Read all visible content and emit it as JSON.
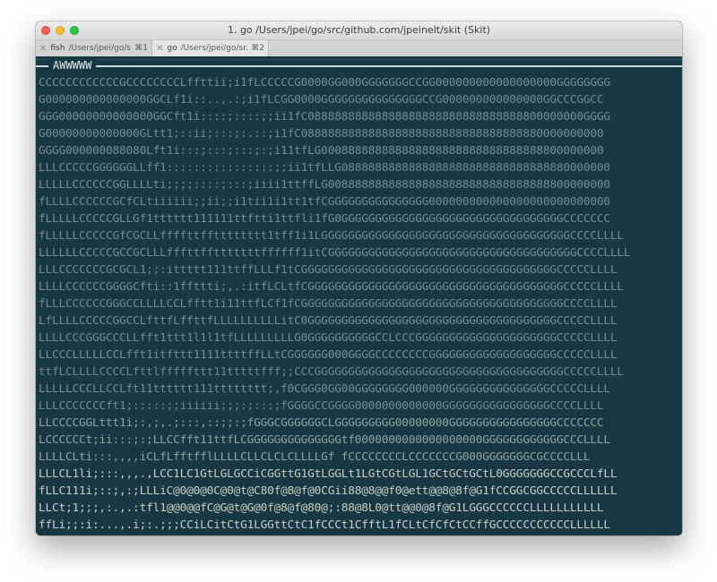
{
  "window": {
    "title": "1. go  /Users/jpei/go/src/github.com/jpeinelt/skit (Skit)"
  },
  "tabs": [
    {
      "name": "fish",
      "path": "/Users/jpei/go/s...",
      "shortcut": "⌘1"
    },
    {
      "name": "go",
      "path": "/Users/jpei/go/sr...",
      "shortcut": "⌘2"
    }
  ],
  "terminal": {
    "box_title": "AWWWWW",
    "ascii_rows": [
      "CCCCCCCCCCCCGCCCCCCCCLffttii;i1fLCCCCCG0000GG000GGGGGGGCCGG000000000000000000GGGGGGGG",
      "G000000000000000GGCLf1i::..,.:;i1fLCGG0000GGGGGGGGGGGGGGGCCG000000000000000GGCCCGGCC",
      "GGG00000000000000GGCft1i::::;::::;;ii1fC08888888888888888888888888888888800000000GGGG",
      "G00000000000000GLtt1;::ii;:::;:.::;i1fC088888888888888888888888888888888880000000000",
      "GGGG000000088080Lft1i:::;:::;:::;:;i11tfLG000888888888888888888888888888888800000000",
      "LLLCCCCCGGGGGGLLff1::::::::::::::::;;ii1tfLLG0888888888888888888888888888888880000000",
      "LLLLLCCCCCCGGLLLLti;;;;::::;:::;iiii1ttffLG008888888888888888888888888888888800000000",
      "fLLLLCCCCCCGCfCLtiiiiii;;ii;;i1tii1i1tt1tfCGGGGGGGGGGGGGGG000000000000000000000000000",
      "fLLLLLCCCCCGLLGf1tttttt111111ttftti1ttfli1fG0GGGGGGGGGGGGGGGGGGGGGGGGGGGGGGGGGCCCCCCC",
      "fLLLLLCCCCCGfCGCLLffffttfftttttttt1tff1i1LGGGGGGGGGGGGGGGGGGGGGGGGGGGGGGGGGGGGGCCCCLLLL",
      "LLLLLLCCCCCGCCGCLLLfffttfftttttttffffff1itCGGGGGGGGGGGGGGGGGGGGGGGGGGGGGGGGGGGGGCCCCLLLL",
      "LLLCCCCCCCGCGCL1;;:ittttt111ttffLLLf1tCGGGGGGGGGGGGGGGGGGGGGGGGGGGGGGGGGGGGGGCCCCCLLLL",
      "LLLLCCCCCCGGGGCfti::1ffttti;,.:itfLCLtfCGGGGGGGGGGGGGGGGGGGGGGGGGGGGGGGGGGGGGGCCCCCLLLL",
      "fLLLCCCCCCGGGCCLLLLCCLfftt1i11ttfLCf1fCGGGGGGGGGGGGGGGGGGGGGGGGGGGGGGGGGGGGGGGCCCCLLLL",
      "LfLLLLCCCCCGGCCLfttfLffttfLLLLLLLLLLitC0GGGGGGGGGGGGGGGGGGGGGGGGGGGGGGGGGGGGGCCCCCLLLL",
      "LLLLCCCGGGCCCLLfft1ttt1l1l1tfLLLLLLLLLG0GGGGGGGGGGCCLCCCGGGGGGGGGGGGGGGGGGGGGCCCCCLLLL",
      "LLCCCLLLLLCCLfft1itfttt1111ttttffLLtCGGGGGG000GGGGCCCCCCCCGGGGGGGGGGGGGGGGGGGCCCCCLLLL",
      "ttfLCLLLLCCCCLfttlfffffttt11tttttfff;;CCCGGGGGGGGGGGGGGGGGGGGGGGGGGGGGGGGGGGGGCCCCCLLLL",
      "LLLLLCCCLLCCLft11tttttt111tttttttt;,f0CGGG0GG00GGGGGGGG000000GGGGGGGGGGGGGGGCCCCCLLLL",
      "LLLCCCCCCCft1;:::::;;iiiiii;;;:;:::;fGGGGCCGGGG0000000000000GGGGGGGGGGGGGGGGCCCCLLLL",
      "LLCCCCGGLttt1i;:,;,.;:::,::;;:;fGGGCGGGGGGCLGGGGGGGGG00000000GGGGGGGGGGGGGGGGCCCCCCC",
      "LCCCCCCt;ii:::;:;LLCCfft11ttfLCGGGGGGGGGGGGGGtf0000000000000000000GGGGGGGGGGGGCCCLLLL",
      "LLLLCLti:::,,,,iCLfLfftfflLLLLCLLCLCLCLLLLGf fCCCCCCCCLCCCCCCCG000GGGGGGGCGCCCCLLL",
      "LLLCL1li;:::,,,.,LCC1LC1GtLGLGCCiCGGttG1GtLGGLt1LGtCGtLGL1GCtGCtGCtL0GGGGGGGCCGCCCLfLL",
      "fLLC111i;::;,:;LLLiC@0@0@0C@0@t@C80f@8@f@0CGii88@8@@f0@ett@@8@8f@G1fCCGGCGGCCCCCLLLLLL",
      "LLCt;1;;;,:.,.:tfl1@@0@@fC@G@t@G@0f@8@f@80@;:88@8L0@tt@@0@8f@G1LGGGCCCCCCLLLLLLLLLLL",
      "ffLi;;:i:...,.i;:.;;;CCiLCitCtG1LGGttCtC1fCCCt1CfftL1fCLtCfCfCtCCffGCCCCCCCCCCCLLLLLL"
    ]
  }
}
